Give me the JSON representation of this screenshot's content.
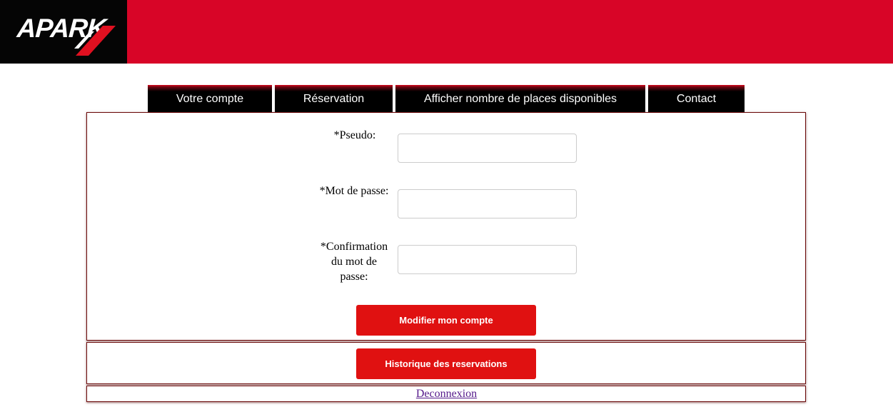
{
  "header": {
    "logo_text": "APARK",
    "colors": {
      "banner": "#d80527",
      "logo_background": "#050505"
    }
  },
  "nav": {
    "tabs": [
      {
        "label": "Votre compte"
      },
      {
        "label": "Réservation"
      },
      {
        "label": "Afficher nombre de places disponibles"
      },
      {
        "label": "Contact"
      }
    ]
  },
  "form": {
    "pseudo_label": "*Pseudo:",
    "pseudo_value": "",
    "password_label": "*Mot de passe:",
    "password_value": "",
    "confirm_label_lines": [
      "*Confirmation",
      "du mot de",
      "passe:"
    ],
    "confirm_value": "",
    "submit_label": "Modifier mon compte"
  },
  "history": {
    "button_label": "Historique des reservations"
  },
  "logout": {
    "link_label": "Deconnexion"
  },
  "colors": {
    "button": "#e01111",
    "panel_border": "#6b0a0a",
    "visited_link": "#551a8b"
  }
}
